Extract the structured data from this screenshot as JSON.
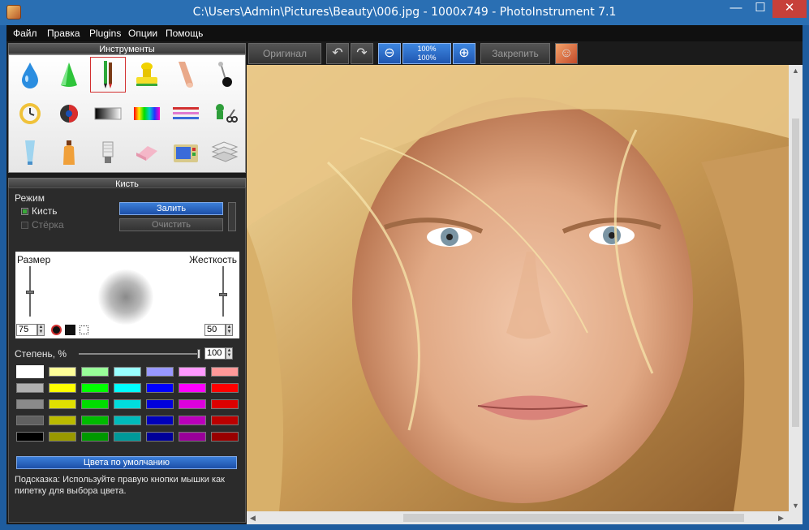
{
  "window": {
    "title": "C:\\Users\\Admin\\Pictures\\Beauty\\006.jpg - 1000x749 - PhotoInstrument 7.1",
    "minimize": "—",
    "maximize": "☐",
    "close": "✕"
  },
  "menu": [
    "Файл",
    "Правка",
    "Plugins",
    "Опции",
    "Помощь"
  ],
  "tools_panel": {
    "title": "Инструменты",
    "selected": "brush-tool"
  },
  "brush": {
    "title": "Кисть",
    "mode_label": "Режим",
    "mode_brush": "Кисть",
    "mode_eraser": "Стёрка",
    "fill_button": "Залить",
    "clear_button": "Очистить",
    "size_label": "Размер",
    "hardness_label": "Жесткость",
    "size_value": "75",
    "hardness_value": "50",
    "degree_label": "Степень, %",
    "degree_value": "100",
    "degree_fraction": 1.0,
    "default_colors_button": "Цвета по умолчанию",
    "hint": "Подсказка: Используйте правую кнопки мышки как пипетку для выбора цвета."
  },
  "palette": [
    [
      "#ffffff",
      "#ffff99",
      "#99ff99",
      "#99ffff",
      "#9999ff",
      "#ff99ff",
      "#ff9999"
    ],
    [
      "#b0b0b0",
      "#ffff00",
      "#00ff00",
      "#00ffff",
      "#0000ff",
      "#ff00ff",
      "#ff0000"
    ],
    [
      "#8a8a8a",
      "#e0e000",
      "#00dd00",
      "#00dddd",
      "#0000dd",
      "#dd00dd",
      "#dd0000"
    ],
    [
      "#606060",
      "#bbbb00",
      "#00bb00",
      "#00bbbb",
      "#0000bb",
      "#bb00bb",
      "#bb0000"
    ],
    [
      "#000000",
      "#999900",
      "#009900",
      "#009999",
      "#000099",
      "#990099",
      "#990000"
    ]
  ],
  "toolbar": {
    "original": "Оригинал",
    "zoom_100_top": "100%",
    "zoom_100_bottom": "100%",
    "pin": "Закрепить"
  },
  "colors": {
    "titlebar": "#2a6fb3",
    "accent_blue": "#1d4fa8",
    "close_red": "#c7403a"
  }
}
